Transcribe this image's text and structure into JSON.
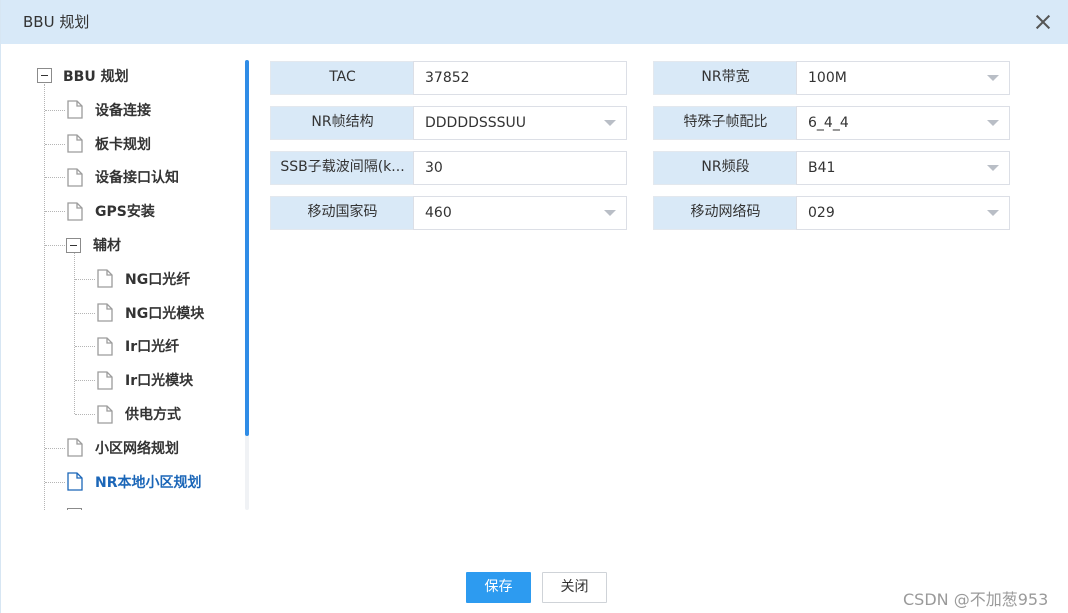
{
  "dialog": {
    "title": "BBU 规划",
    "close_icon": "close-icon"
  },
  "tree": {
    "root": {
      "label": "BBU 规划",
      "expanded": true
    },
    "items": [
      {
        "label": "设备连接",
        "level": 1,
        "icon": "document-icon"
      },
      {
        "label": "板卡规划",
        "level": 1,
        "icon": "document-icon"
      },
      {
        "label": "设备接口认知",
        "level": 1,
        "icon": "document-icon"
      },
      {
        "label": "GPS安装",
        "level": 1,
        "icon": "document-icon"
      },
      {
        "label": "辅材",
        "level": 1,
        "icon": "collapse-toggle",
        "expanded": true
      },
      {
        "label": "NG口光纤",
        "level": 2,
        "icon": "document-icon"
      },
      {
        "label": "NG口光模块",
        "level": 2,
        "icon": "document-icon"
      },
      {
        "label": "Ir口光纤",
        "level": 2,
        "icon": "document-icon"
      },
      {
        "label": "Ir口光模块",
        "level": 2,
        "icon": "document-icon"
      },
      {
        "label": "供电方式",
        "level": 2,
        "icon": "document-icon"
      },
      {
        "label": "小区网络规划",
        "level": 1,
        "icon": "document-icon"
      },
      {
        "label": "NR本地小区规划",
        "level": 1,
        "icon": "document-icon",
        "selected": true
      }
    ]
  },
  "form": {
    "fields": [
      {
        "label": "TAC",
        "value": "37852",
        "type": "text"
      },
      {
        "label": "NR带宽",
        "value": "100M",
        "type": "select"
      },
      {
        "label": "NR帧结构",
        "value": "DDDDDSSSUU",
        "type": "select"
      },
      {
        "label": "特殊子帧配比",
        "value": "6_4_4",
        "type": "select"
      },
      {
        "label": "SSB子载波间隔(k...",
        "value": "30",
        "type": "text"
      },
      {
        "label": "NR频段",
        "value": "B41",
        "type": "select"
      },
      {
        "label": "移动国家码",
        "value": "460",
        "type": "select"
      },
      {
        "label": "移动网络码",
        "value": "029",
        "type": "select"
      }
    ]
  },
  "buttons": {
    "save": "保存",
    "close": "关闭"
  },
  "watermark": "CSDN @不加葱953",
  "colors": {
    "titlebar": "#d8e9f8",
    "label_bg": "#d9e9f7",
    "primary": "#2d9bf0",
    "selected_text": "#1b66b8"
  }
}
